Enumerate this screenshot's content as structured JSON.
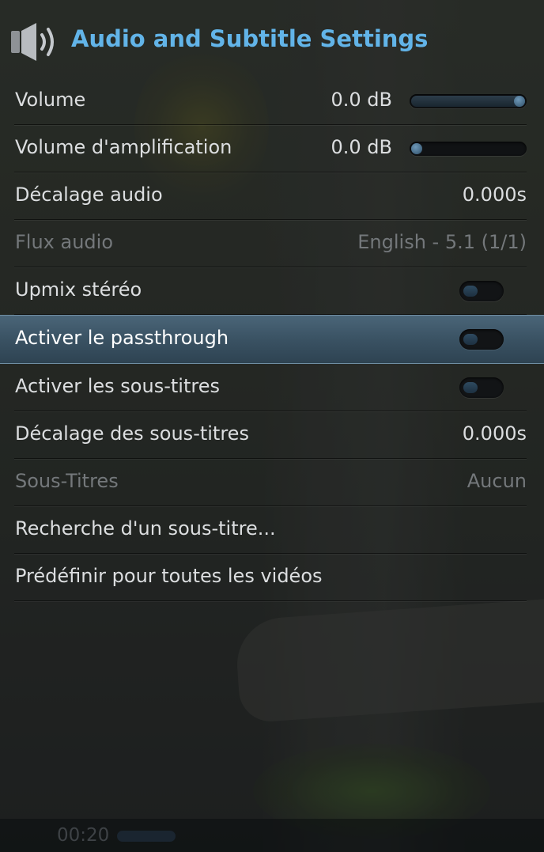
{
  "header": {
    "title": "Audio and Subtitle Settings",
    "icon": "speaker-icon"
  },
  "accent_color": "#62b4e8",
  "rows": [
    {
      "label": "Volume",
      "value": "0.0 dB",
      "control": "slider",
      "level": 1.0
    },
    {
      "label": "Volume d'amplification",
      "value": "0.0 dB",
      "control": "slider",
      "level": 0.0
    },
    {
      "label": "Décalage audio",
      "value": "0.000s"
    },
    {
      "label": "Flux audio",
      "value": "English - 5.1 (1/1)",
      "disabled": true
    },
    {
      "label": "Upmix stéréo",
      "control": "toggle",
      "on": false
    },
    {
      "label": "Activer le passthrough",
      "control": "toggle",
      "on": false,
      "focused": true
    },
    {
      "label": "Activer les sous-titres",
      "control": "toggle",
      "on": false
    },
    {
      "label": "Décalage des sous-titres",
      "value": "0.000s"
    },
    {
      "label": "Sous-Titres",
      "value": "Aucun",
      "disabled": true
    },
    {
      "label": "Recherche d'un sous-titre..."
    },
    {
      "label": "Prédéfinir pour toutes les vidéos"
    }
  ],
  "osd": {
    "time": "00:20"
  }
}
